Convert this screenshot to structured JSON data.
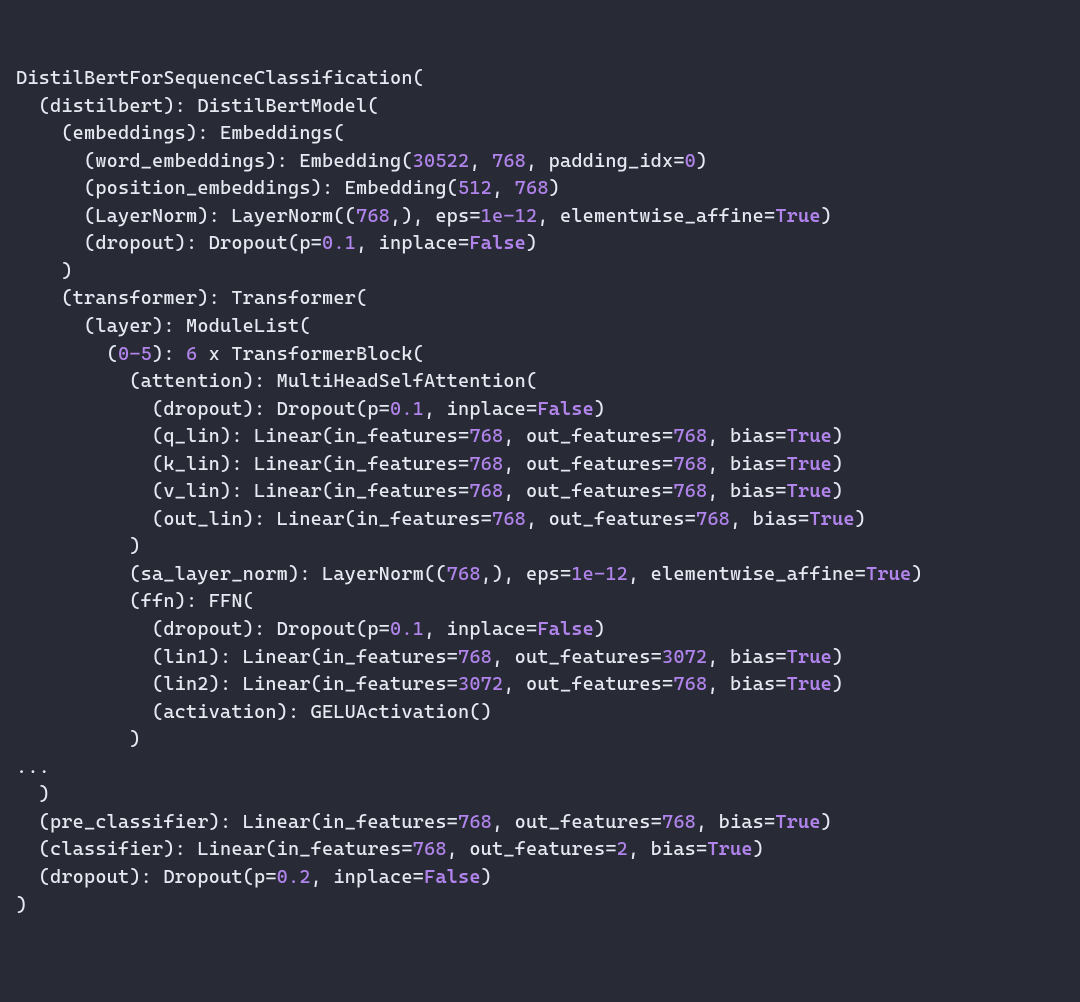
{
  "structure": {
    "class_name": "DistilBertForSequenceClassification",
    "vocab_size": "30522",
    "hidden_dim": "768",
    "padding_idx": "0",
    "max_pos": "512",
    "eps": "1e-12",
    "dropout_p": "0.1",
    "dropout_final": "0.2",
    "true": "True",
    "false": "False",
    "layer_range": "0-5",
    "n_layers": "6",
    "ffn_dim": "3072",
    "classifier_out": "2"
  }
}
